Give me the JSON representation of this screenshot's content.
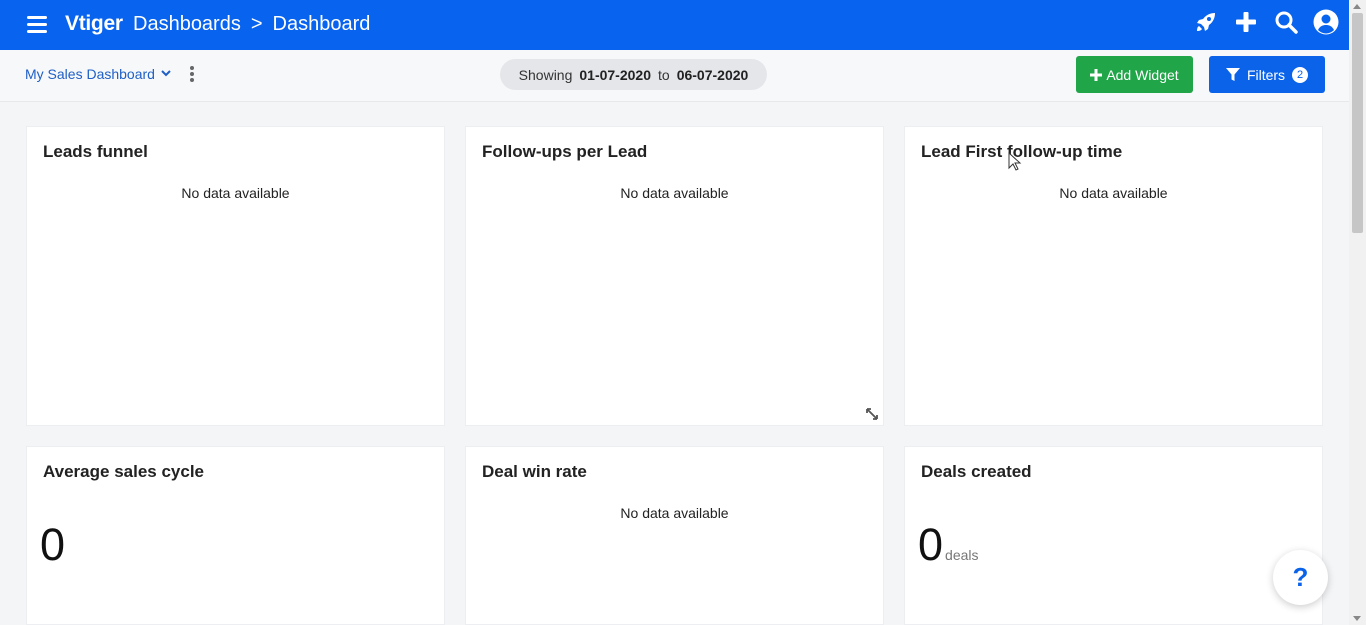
{
  "header": {
    "brand": "Vtiger",
    "breadcrumb_module": "Dashboards",
    "breadcrumb_separator": ">",
    "breadcrumb_page": "Dashboard",
    "icons": [
      "menu-icon",
      "rocket-icon",
      "plus-icon",
      "search-icon",
      "user-icon"
    ]
  },
  "toolbar": {
    "dashboard_name": "My Sales Dashboard",
    "date_range": {
      "showing_label": "Showing",
      "from": "01-07-2020",
      "to_label": "to",
      "to": "06-07-2020"
    },
    "add_widget_label": "Add Widget",
    "filters_label": "Filters",
    "filters_count": "2"
  },
  "widgets": [
    {
      "title": "Leads funnel",
      "message": "No data available"
    },
    {
      "title": "Follow-ups per Lead",
      "message": "No data available"
    },
    {
      "title": "Lead First follow-up time",
      "message": "No data available"
    },
    {
      "title": "Average sales cycle",
      "value": "0"
    },
    {
      "title": "Deal win rate",
      "message": "No data available"
    },
    {
      "title": "Deals created",
      "value": "0",
      "unit": "deals"
    }
  ],
  "help_label": "?",
  "colors": {
    "header_bg": "#0863ee",
    "add_widget_bg": "#20a548",
    "filters_bg": "#0a63e8",
    "link": "#1f5fc6"
  }
}
